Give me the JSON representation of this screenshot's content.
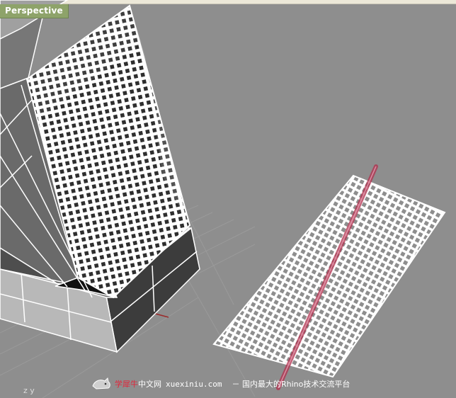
{
  "viewport": {
    "tab_label": "Perspective",
    "axis_label": "z y"
  },
  "watermark": {
    "part_red": "学犀牛",
    "part_white": "中文网",
    "site": "xuexiniu.com",
    "slogan": "－ 国内最大的Rhino技术交流平台"
  },
  "colors": {
    "background": "#8e8e8e",
    "tab": "#8ea36a",
    "mesh_wire": "#ffffff",
    "cut_line": "#b0304e"
  },
  "icons": [
    "rhino-logo-icon"
  ]
}
